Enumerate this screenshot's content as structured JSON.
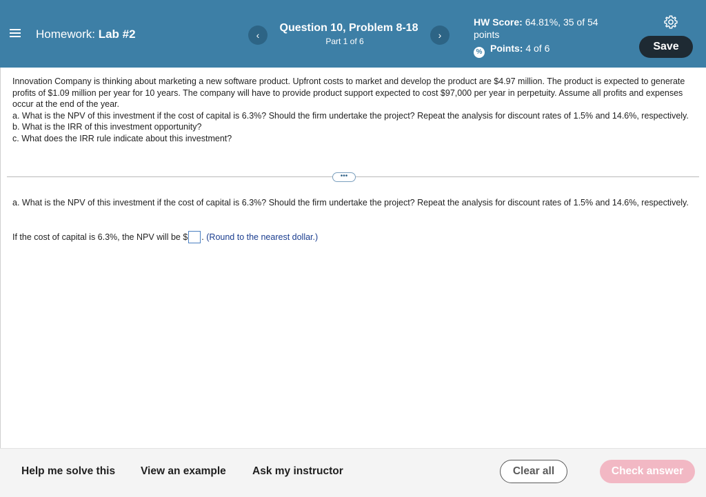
{
  "header": {
    "homework_prefix": "Homework:",
    "homework_name": "Lab #2",
    "question_title": "Question 10, Problem 8-18",
    "question_part": "Part 1 of 6",
    "prev_label": "‹",
    "next_label": "›",
    "hw_score_label": "HW Score:",
    "hw_score_value": "64.81%, 35 of 54",
    "hw_score_unit": "points",
    "points_icon": "%",
    "points_label": "Points:",
    "points_value": "4 of 6",
    "save_label": "Save"
  },
  "problem": {
    "intro": "Innovation Company is thinking about marketing a new software product. Upfront costs to market and develop the product are $4.97 million. The product is expected to generate profits of $1.09 million per year for 10 years. The company will have to provide product support expected to cost $97,000 per year in perpetuity. Assume all profits and expenses occur at the end of the year.",
    "part_a": "a. What is the NPV of this investment if the cost of capital is 6.3%? Should the firm undertake the project? Repeat the analysis for discount rates of 1.5% and 14.6%, respectively.",
    "part_b": "b. What is the IRR of this investment opportunity?",
    "part_c": "c. What does the IRR rule indicate about this investment?"
  },
  "divider": {
    "ellipsis": "•••"
  },
  "answer": {
    "question": "a. What is the NPV of this investment if the cost of capital is 6.3%? Should the firm undertake the project? Repeat the analysis for discount rates of 1.5% and 14.6%, respectively.",
    "prefix": "If the cost of capital is 6.3%, the NPV will be $",
    "suffix": ".",
    "hint": "(Round to the nearest dollar.)"
  },
  "footer": {
    "help_label": "Help me solve this",
    "example_label": "View an example",
    "instructor_label": "Ask my instructor",
    "clear_label": "Clear all",
    "check_label": "Check answer"
  },
  "colors": {
    "header_bg": "#3d7fa6",
    "save_bg": "#1e2a33",
    "check_bg": "#f2b8c4",
    "hint_text": "#1a3d8f"
  }
}
